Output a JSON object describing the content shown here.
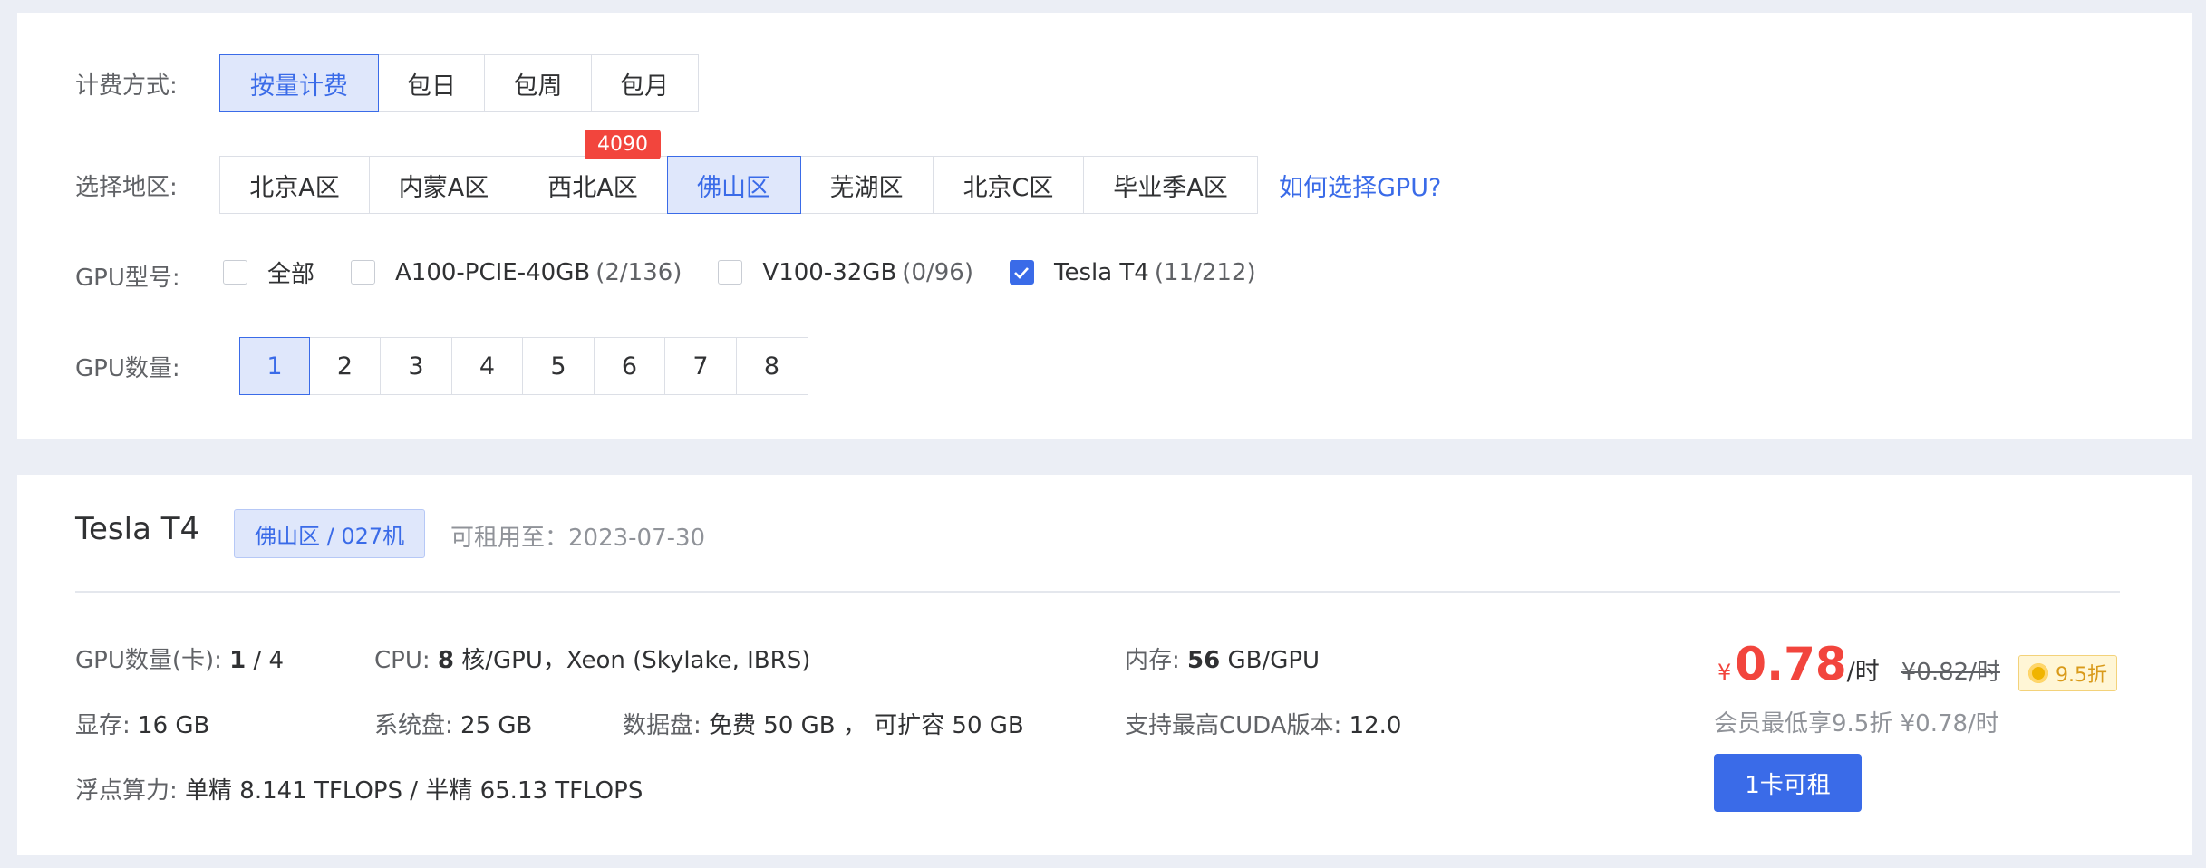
{
  "billing": {
    "label": "计费方式:",
    "options": [
      "按量计费",
      "包日",
      "包周",
      "包月"
    ],
    "selected_index": 0
  },
  "region": {
    "label": "选择地区:",
    "options": [
      "北京A区",
      "内蒙A区",
      "西北A区",
      "佛山区",
      "芜湖区",
      "北京C区",
      "毕业季A区"
    ],
    "selected_index": 3,
    "badge": "4090",
    "help_link": "如何选择GPU?"
  },
  "gpu_model": {
    "label": "GPU型号:",
    "options": [
      {
        "name": "全部",
        "count": "",
        "checked": false
      },
      {
        "name": "A100-PCIE-40GB",
        "count": "(2/136)",
        "checked": false
      },
      {
        "name": "V100-32GB",
        "count": "(0/96)",
        "checked": false
      },
      {
        "name": "Tesla T4",
        "count": "(11/212)",
        "checked": true
      }
    ]
  },
  "gpu_count": {
    "label": "GPU数量:",
    "options": [
      "1",
      "2",
      "3",
      "4",
      "5",
      "6",
      "7",
      "8"
    ],
    "selected_index": 0
  },
  "machine": {
    "name": "Tesla T4",
    "tag": "佛山区 / 027机",
    "available_until": "可租用至：2023-07-30",
    "specs": {
      "gpu_count_label": "GPU数量(卡):",
      "gpu_count_value": "1",
      "gpu_count_total": " / 4",
      "cpu_label": "CPU:",
      "cpu_cores": "8",
      "cpu_rest": " 核/GPU，Xeon (Skylake, IBRS)",
      "mem_label": "内存:",
      "mem_value": "56",
      "mem_unit": " GB/GPU",
      "vram_label": "显存:",
      "vram_value": "16 GB",
      "sysdisk_label": "系统盘:",
      "sysdisk_value": "25 GB",
      "datadisk_label": "数据盘:",
      "datadisk_value": "免费 50 GB ， 可扩容 50 GB",
      "cuda_label": "支持最高CUDA版本:",
      "cuda_value": "12.0",
      "flops_label": "浮点算力:",
      "flops_value": "单精 8.141 TFLOPS / 半精 65.13 TFLOPS"
    },
    "price": {
      "currency": "¥",
      "value": "0.78",
      "unit": "/时",
      "original": "¥0.82/时",
      "discount": "9.5折",
      "member_note": "会员最低享9.5折 ¥0.78/时",
      "rent_button": "1卡可租"
    }
  },
  "colors": {
    "primary": "#3a6be8",
    "price_red": "#f2453d",
    "page_bg": "#ebeef5"
  }
}
